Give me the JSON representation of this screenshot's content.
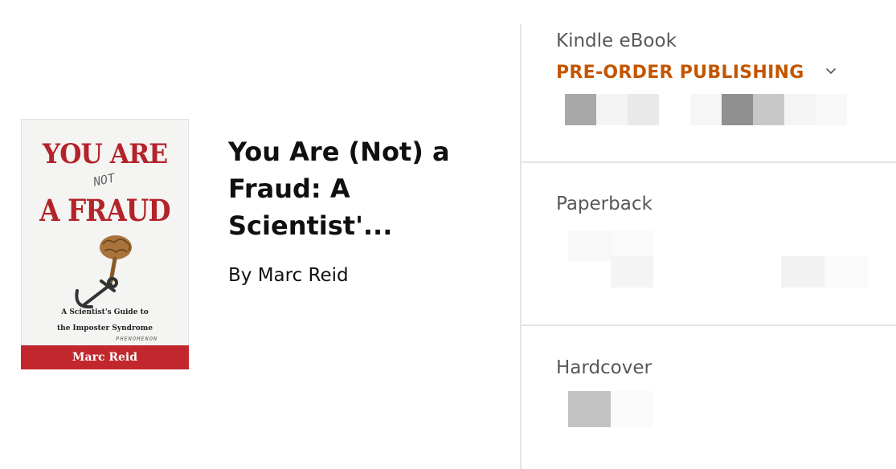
{
  "book": {
    "title": "You Are (Not) a Fraud: A Scientist'...",
    "byline": "By Marc Reid",
    "cover": {
      "line1": "YOU ARE",
      "not_word": "NOT",
      "line2": "A FRAUD",
      "subtitle1": "A Scientist's Guide to",
      "subtitle2": "the Imposter Syndrome",
      "handwritten": "PHENOMENON",
      "author": "Marc Reid",
      "brand_color": "#b3232a",
      "band_color": "#c1272d"
    }
  },
  "formats": {
    "kindle": {
      "label": "Kindle eBook",
      "status": "PRE-ORDER PUBLISHING",
      "status_color": "#c45500",
      "dropdown_icon": "chevron-down-icon"
    },
    "paperback": {
      "label": "Paperback"
    },
    "hardcover": {
      "label": "Hardcover"
    }
  },
  "colors": {
    "label_gray": "#565959",
    "divider": "#e4e4e4",
    "text": "#0f1111"
  }
}
